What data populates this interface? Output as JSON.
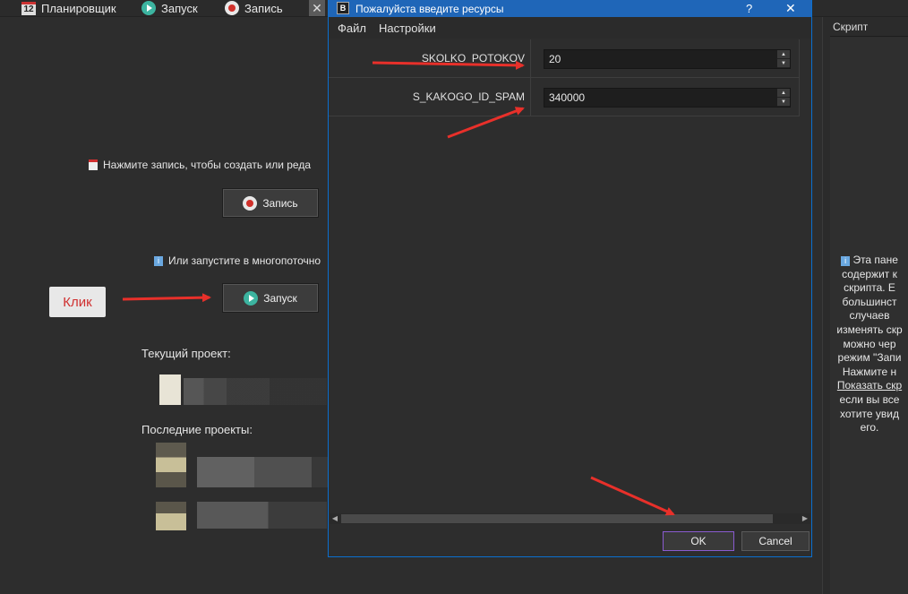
{
  "toolbar": {
    "scheduler_day": "12",
    "scheduler_label": "Планировщик",
    "run_label": "Запуск",
    "record_label": "Запись",
    "close_glyph": "✕"
  },
  "left_panel": {
    "record_hint": "Нажмите запись, чтобы создать или реда",
    "record_button": "Запись",
    "run_hint": "Или запустите в многопоточно",
    "run_button": "Запуск",
    "klik_label": "Клик",
    "current_project_label": "Текущий проект:",
    "recent_projects_label": "Последние проекты:"
  },
  "dialog": {
    "title": "Пожалуйста введите ресурсы",
    "help_glyph": "?",
    "close_glyph": "✕",
    "menu": [
      "Файл",
      "Настройки"
    ],
    "fields": [
      {
        "label": "SKOLKO_POTOKOV",
        "value": "20"
      },
      {
        "label": "S_KAKOGO_ID_SPAM",
        "value": "340000"
      }
    ],
    "ok_label": "OK",
    "cancel_label": "Cancel"
  },
  "script_panel": {
    "title": "Скрипт",
    "lines": [
      "Эта пане",
      "содержит к",
      "скрипта. Е",
      "большинст",
      "случаев",
      "изменять скр",
      "можно чер",
      "режим \"Запи",
      "Нажмите н"
    ],
    "link": "Показать скр",
    "after_lines": [
      "если вы все",
      "хотите увид",
      "его."
    ]
  },
  "colors": {
    "annotation_arrow": "#e8302a",
    "dialog_title_bar": "#1f66b8",
    "ok_button_border": "#8a5bd0"
  }
}
